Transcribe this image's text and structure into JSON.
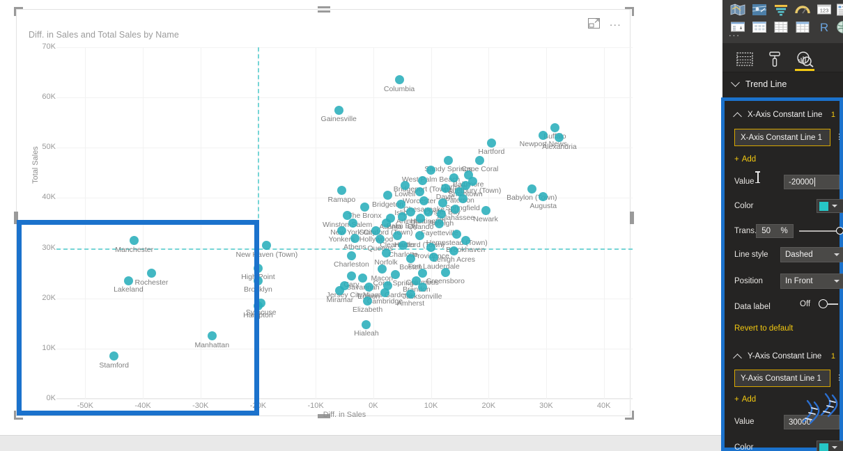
{
  "visual": {
    "title": "Diff. in Sales and Total Sales by Name",
    "focus_icon": "focus-mode-icon",
    "more_icon": "..."
  },
  "axes": {
    "x_title": "Diff. in Sales",
    "y_title": "Total Sales",
    "x_ticks": [
      "-50K",
      "-40K",
      "-30K",
      "-20K",
      "-10K",
      "0K",
      "10K",
      "20K",
      "30K",
      "40K"
    ],
    "y_ticks": [
      "0K",
      "10K",
      "20K",
      "30K",
      "40K",
      "50K",
      "60K",
      "70K"
    ],
    "x_min": -55000,
    "x_max": 45000,
    "y_min": 0,
    "y_max": 70000
  },
  "chart_data": {
    "type": "scatter",
    "title": "Diff. in Sales and Total Sales by Name",
    "xlabel": "Diff. in Sales",
    "ylabel": "Total Sales",
    "xlim": [
      -55000,
      45000
    ],
    "ylim": [
      0,
      70000
    ],
    "grid": true,
    "legend": "none",
    "marker_color": "#29aebb",
    "annotations": [
      {
        "type": "constant-line",
        "axis": "x",
        "value": -20000,
        "style": "dashed",
        "color": "#5fcfd0"
      },
      {
        "type": "constant-line",
        "axis": "y",
        "value": 30000,
        "style": "dashed",
        "color": "#5fcfd0"
      }
    ],
    "points": [
      {
        "label": "Columbia",
        "x": 4500,
        "y": 63500
      },
      {
        "label": "Gainesville",
        "x": -6000,
        "y": 57500
      },
      {
        "label": "Buffalo",
        "x": 31500,
        "y": 54000
      },
      {
        "label": "Newport News",
        "x": 29500,
        "y": 52500
      },
      {
        "label": "Alexandria",
        "x": 32300,
        "y": 52000
      },
      {
        "label": "Hartford",
        "x": 20500,
        "y": 51000
      },
      {
        "label": "Sandy Springs",
        "x": 13000,
        "y": 47500
      },
      {
        "label": "Cape Coral",
        "x": 18500,
        "y": 47500
      },
      {
        "label": "West Palm Beach",
        "x": 10000,
        "y": 45500
      },
      {
        "label": "Baltimore",
        "x": 16500,
        "y": 44500
      },
      {
        "label": "Durham",
        "x": 14000,
        "y": 44000
      },
      {
        "label": "Bridgeport (Town)",
        "x": 8500,
        "y": 43500
      },
      {
        "label": "Waterbury (Town)",
        "x": 17200,
        "y": 43300
      },
      {
        "label": "Smithtown",
        "x": 16000,
        "y": 42500
      },
      {
        "label": "Davie",
        "x": 12500,
        "y": 42000
      },
      {
        "label": "Paterson",
        "x": 15000,
        "y": 41300
      },
      {
        "label": "Lowell",
        "x": 5500,
        "y": 42500
      },
      {
        "label": "Worcester",
        "x": 8000,
        "y": 41200
      },
      {
        "label": "Ramapo",
        "x": -5500,
        "y": 41500
      },
      {
        "label": "Babylon (Town)",
        "x": 27500,
        "y": 41800
      },
      {
        "label": "Augusta",
        "x": 29500,
        "y": 40200
      },
      {
        "label": "Springfield",
        "x": 15500,
        "y": 39800
      },
      {
        "label": "Oyster Bay",
        "x": 12000,
        "y": 39000
      },
      {
        "label": "Chesapeake",
        "x": 8800,
        "y": 39500
      },
      {
        "label": "Bridgeton",
        "x": 2500,
        "y": 40500
      },
      {
        "label": "Islip",
        "x": 4800,
        "y": 38800
      },
      {
        "label": "Newark",
        "x": 19500,
        "y": 37500
      },
      {
        "label": "Tallahassee",
        "x": 14200,
        "y": 37800
      },
      {
        "label": "The Bronx",
        "x": -1500,
        "y": 38200
      },
      {
        "label": "Arlington",
        "x": 6500,
        "y": 37200
      },
      {
        "label": "Huntington",
        "x": 9500,
        "y": 37200
      },
      {
        "label": "Raleigh",
        "x": 11800,
        "y": 36800
      },
      {
        "label": "Winston-Salem",
        "x": -4500,
        "y": 36500
      },
      {
        "label": "Atlanta",
        "x": 3000,
        "y": 36000
      },
      {
        "label": "Palm Bay",
        "x": 5000,
        "y": 36200
      },
      {
        "label": "Orlando",
        "x": 8200,
        "y": 36000
      },
      {
        "label": "New York City",
        "x": -3500,
        "y": 35000
      },
      {
        "label": "Stamford (Town)",
        "x": 2200,
        "y": 35000
      },
      {
        "label": "Fayetteville",
        "x": 11500,
        "y": 34800
      },
      {
        "label": "Manchester",
        "x": -41500,
        "y": 31500
      },
      {
        "label": "Yonkers",
        "x": -5500,
        "y": 33500
      },
      {
        "label": "Hollywood",
        "x": 500,
        "y": 33500
      },
      {
        "label": "Clearwater",
        "x": 4200,
        "y": 32500
      },
      {
        "label": "Hartford (Town)",
        "x": 8000,
        "y": 32500
      },
      {
        "label": "Hempstead (Town)",
        "x": 14500,
        "y": 32800
      },
      {
        "label": "Brookhaven",
        "x": 16000,
        "y": 31500
      },
      {
        "label": "Athens",
        "x": -3200,
        "y": 32000
      },
      {
        "label": "Queens",
        "x": 1200,
        "y": 31800
      },
      {
        "label": "New Haven (Town)",
        "x": -18500,
        "y": 30500
      },
      {
        "label": "Charlotte",
        "x": 5200,
        "y": 30500
      },
      {
        "label": "Providence",
        "x": 10000,
        "y": 30200
      },
      {
        "label": "Lehigh Acres",
        "x": 14000,
        "y": 29500
      },
      {
        "label": "Norfolk",
        "x": 2200,
        "y": 29000
      },
      {
        "label": "Charleston",
        "x": -3800,
        "y": 28500
      },
      {
        "label": "Boston",
        "x": 6500,
        "y": 28000
      },
      {
        "label": "Fort Lauderdale",
        "x": 10500,
        "y": 28200
      },
      {
        "label": "Rochester",
        "x": -38500,
        "y": 25000
      },
      {
        "label": "High Point",
        "x": -20000,
        "y": 26000
      },
      {
        "label": "Lakeland",
        "x": -42500,
        "y": 23500
      },
      {
        "label": "Brooklyn",
        "x": -20000,
        "y": 23500
      },
      {
        "label": "Macon",
        "x": 1500,
        "y": 25800
      },
      {
        "label": "Columbus",
        "x": 8500,
        "y": 25000
      },
      {
        "label": "Greensboro",
        "x": 12500,
        "y": 25200
      },
      {
        "label": "Cary",
        "x": -3800,
        "y": 24500
      },
      {
        "label": "Savannah",
        "x": -1800,
        "y": 24000
      },
      {
        "label": "Coral Springs",
        "x": 3800,
        "y": 24800
      },
      {
        "label": "Brandon",
        "x": 7500,
        "y": 23500
      },
      {
        "label": "Jersey City",
        "x": -5000,
        "y": 22500
      },
      {
        "label": "Edison",
        "x": -800,
        "y": 22200
      },
      {
        "label": "Miami Gardens",
        "x": 2500,
        "y": 22500
      },
      {
        "label": "Jacksonville",
        "x": 8500,
        "y": 22200
      },
      {
        "label": "Miramar",
        "x": -5800,
        "y": 21500
      },
      {
        "label": "Cambridge",
        "x": 2000,
        "y": 21200
      },
      {
        "label": "Amherst",
        "x": 6500,
        "y": 20800
      },
      {
        "label": "Syracuse",
        "x": -19500,
        "y": 19000
      },
      {
        "label": "Hampton",
        "x": -20000,
        "y": 18500
      },
      {
        "label": "Elizabeth",
        "x": -1000,
        "y": 19500
      },
      {
        "label": "Hialeah",
        "x": -1200,
        "y": 14800
      },
      {
        "label": "Manhattan",
        "x": -28000,
        "y": 12500
      },
      {
        "label": "Stamford",
        "x": -45000,
        "y": 8500
      }
    ]
  },
  "pane": {
    "gallery_icons": [
      "map-icon",
      "filled-map-icon",
      "funnel-icon",
      "gauge-icon",
      "card-number-icon",
      "multirow-card-icon",
      "kpi-icon",
      "slicer-icon",
      "table-icon",
      "matrix-icon",
      "r-script-icon",
      "python-script-icon"
    ],
    "gallery_more": "...",
    "tabs": [
      {
        "name": "fields",
        "icon": "fields-table-icon",
        "active": false
      },
      {
        "name": "format",
        "icon": "paint-roller-icon",
        "active": false
      },
      {
        "name": "analytics",
        "icon": "analytics-magnifier-icon",
        "active": true
      }
    ],
    "trend_line": {
      "label": "Trend Line",
      "expanded": true
    },
    "x_axis_constant_line": {
      "section_label": "X-Axis Constant Line",
      "section_count": "1",
      "name_value": "X-Axis Constant Line 1",
      "add_label": "Add",
      "value_label": "Value",
      "value": "-20000",
      "color_label": "Color",
      "color_value": "#26c6c6",
      "transparency_label": "Trans...",
      "transparency_value": "50",
      "transparency_unit": "%",
      "line_style_label": "Line style",
      "line_style_value": "Dashed",
      "position_label": "Position",
      "position_value": "In Front",
      "data_label_label": "Data label",
      "data_label_state": "Off",
      "revert_label": "Revert to default"
    },
    "y_axis_constant_line": {
      "section_label": "Y-Axis Constant Line",
      "section_count": "1",
      "name_value": "Y-Axis Constant Line 1",
      "add_label": "Add",
      "value_label": "Value",
      "value": "30000",
      "color_label": "Color",
      "color_value": "#26c6c6"
    }
  },
  "colors": {
    "selection_blue": "#1b72cc",
    "accent_yellow": "#f2c811",
    "marker_teal": "#29aebb",
    "constant_line_teal": "#5fcfd0",
    "pane_bg": "#252423"
  }
}
